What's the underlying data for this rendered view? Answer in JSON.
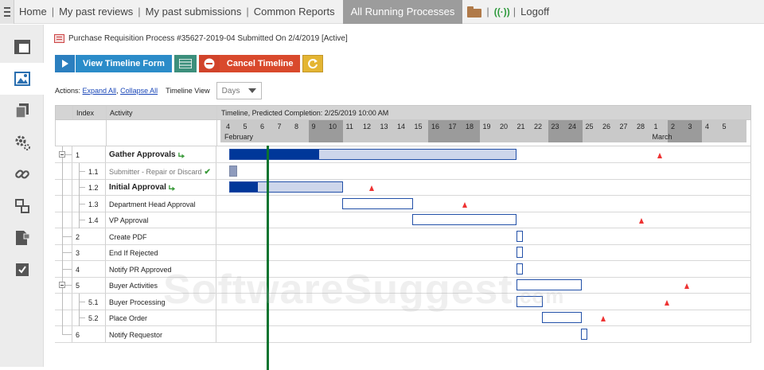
{
  "nav": {
    "items": [
      "Home",
      "My past reviews",
      "My past submissions",
      "Common Reports"
    ],
    "active": "All Running Processes",
    "logoff": "Logoff"
  },
  "sidebar": {
    "icons": [
      "layout-icon",
      "image-icon",
      "copy-icon",
      "settings-icon",
      "link-icon",
      "workflow-icon",
      "document-lock-icon",
      "checkbox-icon"
    ]
  },
  "process": {
    "title": "Purchase Requisition Process #35627-2019-04 Submitted On 2/4/2019 [Active]"
  },
  "toolbar": {
    "view_timeline": "View Timeline Form",
    "cancel_timeline": "Cancel Timeline"
  },
  "actions": {
    "label": "Actions:",
    "expand_all": "Expand All",
    "sep": ",",
    "collapse_all": "Collapse All",
    "timeline_view_label": "Timeline View",
    "timeline_view_value": "Days"
  },
  "grid": {
    "col_index": "Index",
    "col_activity": "Activity",
    "col_timeline": "Timeline, Predicted Completion: 2/25/2019 10:00 AM",
    "days": [
      "4",
      "5",
      "6",
      "7",
      "8",
      "9",
      "10",
      "11",
      "12",
      "13",
      "14",
      "15",
      "16",
      "17",
      "18",
      "19",
      "20",
      "21",
      "22",
      "23",
      "24",
      "25",
      "26",
      "27",
      "28",
      "1",
      "2",
      "3",
      "4",
      "5"
    ],
    "month_feb": "February",
    "month_mar": "March",
    "rows": [
      {
        "index": "1",
        "activity": "Gather Approvals",
        "bold": true,
        "arrow": true
      },
      {
        "index": "1.1",
        "activity": "Submitter - Repair or Discard",
        "gray": true,
        "check": true
      },
      {
        "index": "1.2",
        "activity": "Initial Approval",
        "bold": true,
        "arrow": true
      },
      {
        "index": "1.3",
        "activity": "Department Head Approval"
      },
      {
        "index": "1.4",
        "activity": "VP Approval"
      },
      {
        "index": "2",
        "activity": "Create PDF"
      },
      {
        "index": "3",
        "activity": "End If Rejected"
      },
      {
        "index": "4",
        "activity": "Notify PR Approved"
      },
      {
        "index": "5",
        "activity": "Buyer Activities"
      },
      {
        "index": "5.1",
        "activity": "Buyer Processing"
      },
      {
        "index": "5.2",
        "activity": "Place Order"
      },
      {
        "index": "6",
        "activity": "Notify Requestor"
      }
    ]
  },
  "watermark": {
    "main": "SoftwareSuggest",
    "tld": ".com"
  }
}
